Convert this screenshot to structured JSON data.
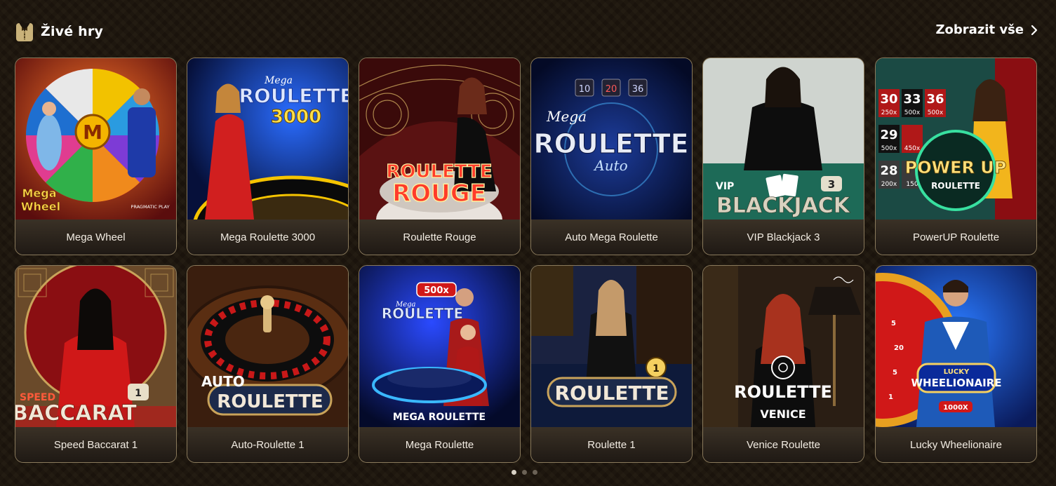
{
  "section": {
    "title": "Živé hry",
    "title_icon": "tuxedo-icon",
    "view_all_label": "Zobrazit vše",
    "view_all_icon": "chevron-right-icon"
  },
  "colors": {
    "background": "#1a130c",
    "card_border": "#8a7a5c",
    "caption_bg": "#2e261e",
    "text": "#ffffff",
    "dot_active": "#d9d2c6",
    "dot_inactive": "#6b6256"
  },
  "games": [
    {
      "name": "Mega Wheel",
      "logo": "Mega Wheel",
      "brand": "PRAGMATIC PLAY"
    },
    {
      "name": "Mega Roulette 3000",
      "logo_small": "Mega",
      "logo": "ROULETTE",
      "logo_sub": "3000"
    },
    {
      "name": "Roulette Rouge",
      "logo": "ROULETTE",
      "logo_sub": "ROUGE"
    },
    {
      "name": "Auto Mega Roulette",
      "logo_small": "Mega",
      "logo": "ROULETTE",
      "logo_sub": "Auto",
      "numbers": [
        "10",
        "20",
        "36"
      ]
    },
    {
      "name": "VIP Blackjack 3",
      "logo_small": "VIP",
      "logo": "BLACKJACK",
      "badge": "3"
    },
    {
      "name": "PowerUP Roulette",
      "logo": "POWER UP",
      "logo_sub": "ROULETTE",
      "numbers": [
        "30",
        "33",
        "36",
        "29",
        "28"
      ],
      "multipliers": [
        "250x",
        "500x",
        "500x",
        "500x",
        "450x",
        "200x",
        "150"
      ]
    },
    {
      "name": "Speed Baccarat 1",
      "logo_small": "SPEED",
      "logo": "BACCARAT",
      "badge": "1"
    },
    {
      "name": "Auto-Roulette 1",
      "logo_small": "AUTO",
      "logo": "ROULETTE"
    },
    {
      "name": "Mega Roulette",
      "logo_small": "Mega",
      "logo": "ROULETTE",
      "logo_sub": "MEGA ROULETTE",
      "badge": "500x"
    },
    {
      "name": "Roulette 1",
      "logo": "ROULETTE",
      "badge": "1"
    },
    {
      "name": "Venice Roulette",
      "logo": "ROULETTE",
      "logo_sub": "VENICE"
    },
    {
      "name": "Lucky Wheelionaire",
      "logo_small": "LUCKY",
      "logo": "WHEELIONAIRE",
      "badge": "1000X"
    }
  ],
  "pagination": {
    "pages": 3,
    "active": 1
  }
}
